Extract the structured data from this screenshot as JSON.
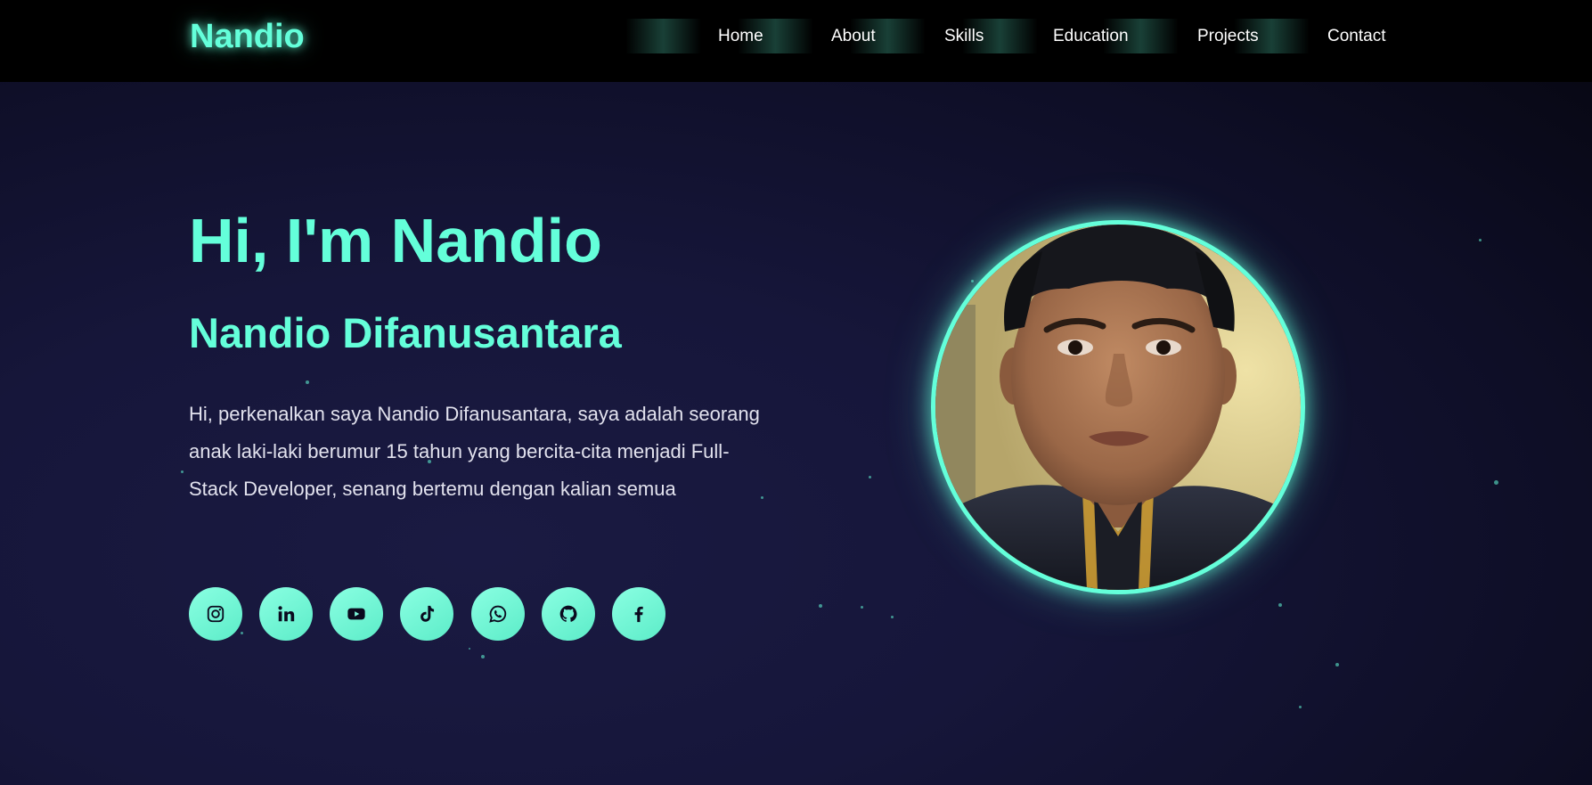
{
  "nav": {
    "logo": "Nandio",
    "links": [
      {
        "label": "Home"
      },
      {
        "label": "About"
      },
      {
        "label": "Skills"
      },
      {
        "label": "Education"
      },
      {
        "label": "Projects"
      },
      {
        "label": "Contact"
      }
    ]
  },
  "hero": {
    "greeting": "Hi, I'm Nandio",
    "fullname": "Nandio Difanusantara",
    "bio": "Hi, perkenalkan saya Nandio Difanusantara, saya adalah seorang anak laki-laki berumur 15 tahun yang bercita-cita menjadi Full-Stack Developer, senang bertemu dengan kalian semua"
  },
  "socials": [
    {
      "icon": "instagram-icon"
    },
    {
      "icon": "linkedin-icon"
    },
    {
      "icon": "youtube-icon"
    },
    {
      "icon": "tiktok-icon"
    },
    {
      "icon": "whatsapp-icon"
    },
    {
      "icon": "github-icon"
    },
    {
      "icon": "facebook-icon"
    }
  ],
  "colors": {
    "accent": "#64ffda",
    "navbar_bg": "#000000",
    "hero_bg": "#16163a",
    "text": "#e2e2ee",
    "icon_fg": "#0a0a1e"
  }
}
